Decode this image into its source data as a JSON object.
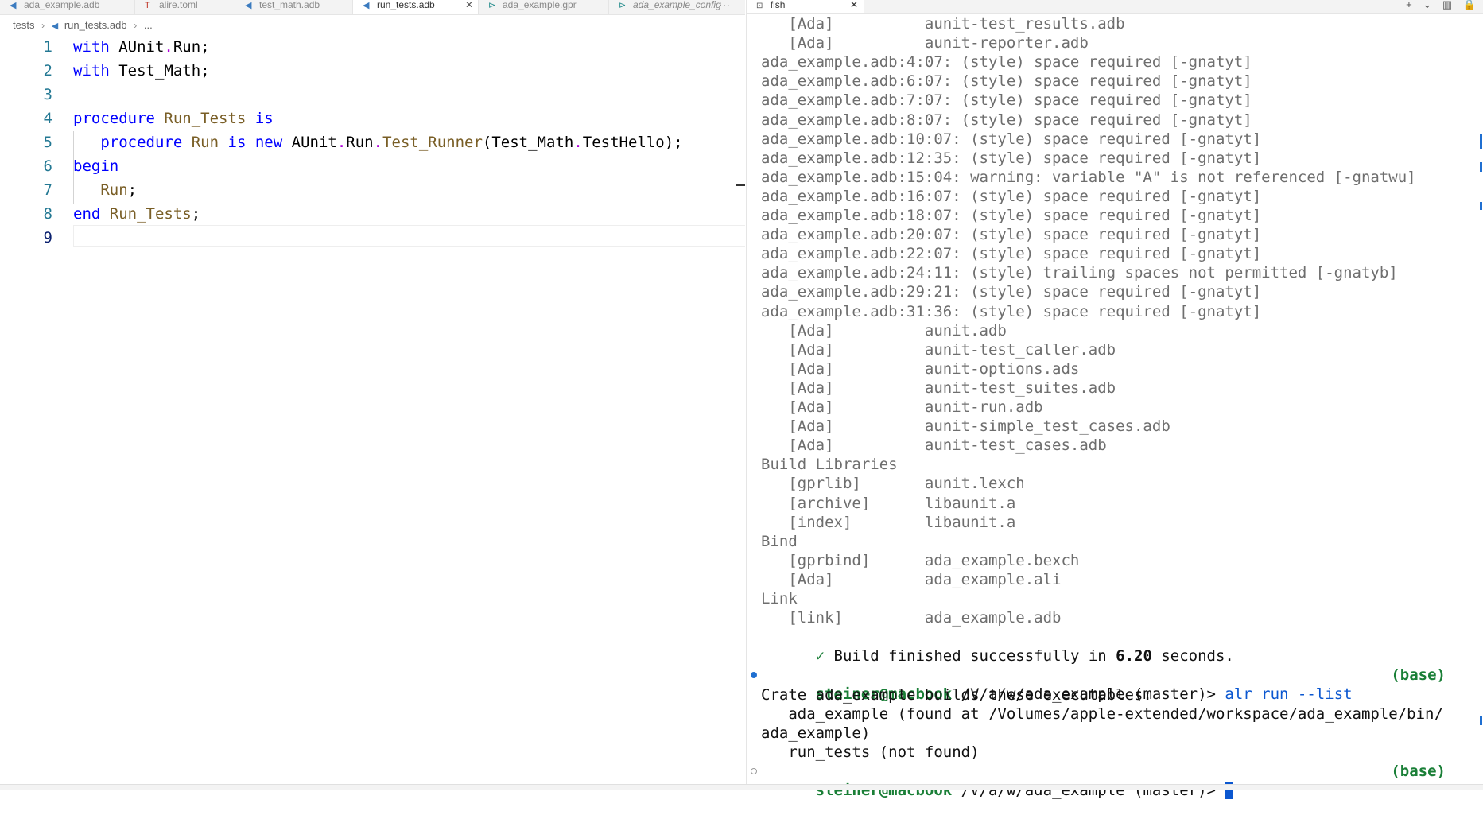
{
  "editor": {
    "tabs": [
      {
        "label": "ada_example.adb",
        "icon": "ada-file-icon",
        "active": false,
        "italic": false
      },
      {
        "label": "alire.toml",
        "icon": "toml-file-icon",
        "active": false,
        "italic": false
      },
      {
        "label": "test_math.adb",
        "icon": "ada-file-icon",
        "active": false,
        "italic": false
      },
      {
        "label": "run_tests.adb",
        "icon": "ada-file-icon",
        "active": true,
        "italic": false
      },
      {
        "label": "ada_example.gpr",
        "icon": "gpr-file-icon",
        "active": false,
        "italic": false
      },
      {
        "label": "ada_example_config",
        "icon": "gpr-file-icon",
        "active": false,
        "italic": true
      }
    ],
    "tab_more": "···",
    "breadcrumb": {
      "folder": "tests",
      "file": "run_tests.adb",
      "symbol": "..."
    },
    "lines": [
      {
        "num": "1",
        "tokens": [
          [
            "kw",
            "with"
          ],
          [
            "t",
            " AUnit"
          ],
          [
            "dot",
            "."
          ],
          [
            "t",
            "Run;"
          ]
        ]
      },
      {
        "num": "2",
        "tokens": [
          [
            "kw",
            "with"
          ],
          [
            "t",
            " Test_Math;"
          ]
        ]
      },
      {
        "num": "3",
        "tokens": []
      },
      {
        "num": "4",
        "tokens": [
          [
            "kw",
            "procedure"
          ],
          [
            "t",
            " "
          ],
          [
            "fn",
            "Run_Tests"
          ],
          [
            "t",
            " "
          ],
          [
            "kw",
            "is"
          ]
        ]
      },
      {
        "num": "5",
        "tokens": [
          [
            "t",
            "   "
          ],
          [
            "kw",
            "procedure"
          ],
          [
            "t",
            " "
          ],
          [
            "fn",
            "Run"
          ],
          [
            "t",
            " "
          ],
          [
            "kw",
            "is"
          ],
          [
            "t",
            " "
          ],
          [
            "kw",
            "new"
          ],
          [
            "t",
            " AUnit"
          ],
          [
            "dot",
            "."
          ],
          [
            "t",
            "Run"
          ],
          [
            "dot",
            "."
          ],
          [
            "fn",
            "Test_Runner"
          ],
          [
            "t",
            "(Test_Math"
          ],
          [
            "dot",
            "."
          ],
          [
            "t",
            "TestHello);"
          ]
        ]
      },
      {
        "num": "6",
        "tokens": [
          [
            "kw",
            "begin"
          ]
        ]
      },
      {
        "num": "7",
        "tokens": [
          [
            "t",
            "   "
          ],
          [
            "fn",
            "Run"
          ],
          [
            "t",
            ";"
          ]
        ]
      },
      {
        "num": "8",
        "tokens": [
          [
            "kw",
            "end"
          ],
          [
            "t",
            " "
          ],
          [
            "fn",
            "Run_Tests"
          ],
          [
            "t",
            ";"
          ]
        ]
      },
      {
        "num": "9",
        "tokens": []
      }
    ],
    "current_line": "9"
  },
  "terminal": {
    "tab_label": "fish",
    "actions": [
      "+",
      "⌄",
      "▥",
      "🔒"
    ],
    "lines": [
      "   [Ada]          aunit-test_results.adb",
      "   [Ada]          aunit-reporter.adb",
      "ada_example.adb:4:07: (style) space required [-gnatyt]",
      "ada_example.adb:6:07: (style) space required [-gnatyt]",
      "ada_example.adb:7:07: (style) space required [-gnatyt]",
      "ada_example.adb:8:07: (style) space required [-gnatyt]",
      "ada_example.adb:10:07: (style) space required [-gnatyt]",
      "ada_example.adb:12:35: (style) space required [-gnatyt]",
      "ada_example.adb:15:04: warning: variable \"A\" is not referenced [-gnatwu]",
      "ada_example.adb:16:07: (style) space required [-gnatyt]",
      "ada_example.adb:18:07: (style) space required [-gnatyt]",
      "ada_example.adb:20:07: (style) space required [-gnatyt]",
      "ada_example.adb:22:07: (style) space required [-gnatyt]",
      "ada_example.adb:24:11: (style) trailing spaces not permitted [-gnatyb]",
      "ada_example.adb:29:21: (style) space required [-gnatyt]",
      "ada_example.adb:31:36: (style) space required [-gnatyt]",
      "   [Ada]          aunit.adb",
      "   [Ada]          aunit-test_caller.adb",
      "   [Ada]          aunit-options.ads",
      "   [Ada]          aunit-test_suites.adb",
      "   [Ada]          aunit-run.adb",
      "   [Ada]          aunit-simple_test_cases.adb",
      "   [Ada]          aunit-test_cases.adb",
      "Build Libraries",
      "   [gprlib]       aunit.lexch",
      "   [archive]      libaunit.a",
      "   [index]        libaunit.a",
      "Bind",
      "   [gprbind]      ada_example.bexch",
      "   [Ada]          ada_example.ali",
      "Link",
      "   [link]         ada_example.adb"
    ],
    "build": {
      "check": "✓",
      "prefix": " Build finished successfully in ",
      "time": "6.20",
      "suffix": " seconds."
    },
    "prompt1": {
      "user": "steiner@macbook",
      "path": " /V/a/w/ada_example",
      "branch": " (master)> ",
      "cmd": "alr run --list",
      "env": "(base)"
    },
    "output": [
      "Crate ada_example builds these executables:",
      "   ada_example (found at /Volumes/apple-extended/workspace/ada_example/bin/",
      "ada_example)",
      "   run_tests (not found)"
    ],
    "prompt2": {
      "user": "steiner@macbook",
      "path": " /V/a/w/ada_example",
      "branch": " (master)> ",
      "env": "(base)"
    },
    "colors": {
      "prompt_green": "#1a7f37",
      "command_blue": "#0b57d0",
      "muted_gray": "#6e6e6e"
    }
  }
}
